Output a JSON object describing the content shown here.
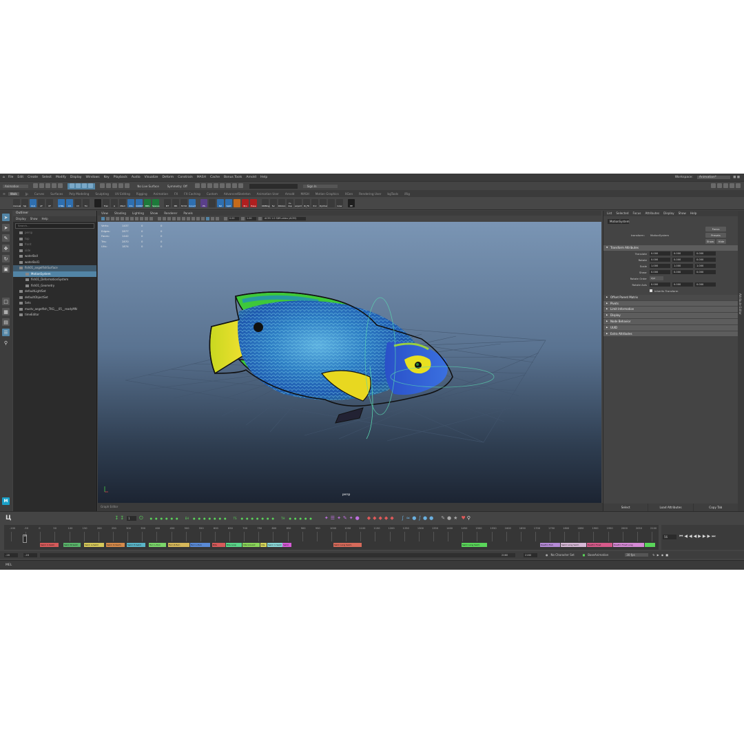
{
  "menus": [
    "File",
    "Edit",
    "Create",
    "Select",
    "Modify",
    "Display",
    "Windows",
    "Key",
    "Playback",
    "Audio",
    "Visualize",
    "Deform",
    "Constrain",
    "MASH",
    "Cache",
    "Bonus Tools",
    "Arnold",
    "Help"
  ],
  "workspace": {
    "label": "Workspace:",
    "value": "Animation*"
  },
  "status": {
    "mode": "Animation",
    "live": "No Live Surface",
    "symmetry": "Symmetry: Off",
    "sign_in": "Sign In"
  },
  "shelf_tabs": [
    "Walk",
    "Jp",
    "Curves",
    "Surfaces",
    "Poly Modeling",
    "Sculpting",
    "UV Editing",
    "Rigging",
    "Animation",
    "FX",
    "FX Caching",
    "Custom",
    "AdvancedSkeleton",
    "Animation User",
    "Arnold",
    "MASH",
    "Motion Graphics",
    "XGen",
    "Rendering User",
    "bgTools",
    "iRig"
  ],
  "shelf_active": "Walk",
  "shelf_icons": [
    {
      "label": "manual",
      "color": "#3a3a3a"
    },
    {
      "label": "hlp",
      "color": "#3a3a3a"
    },
    {
      "label": "CLS",
      "color": "#2e6fb0"
    },
    {
      "label": "AT",
      "color": "#3a3a3a"
    },
    {
      "label": "CF",
      "color": "#3a3a3a"
    },
    {
      "label": "CTRL",
      "color": "#2e6fb0"
    },
    {
      "label": "CV",
      "color": "#2e6fb0"
    },
    {
      "label": "CV",
      "color": "#3a3a3a"
    },
    {
      "label": "Tin",
      "color": "#3a3a3a"
    },
    {
      "label": "",
      "color": "#1f1f1f"
    },
    {
      "label": "Tran",
      "color": "#3a3a3a"
    },
    {
      "label": "A",
      "color": "#3a3a3a"
    },
    {
      "label": "XNull",
      "color": "#3a3a3a"
    },
    {
      "label": "P-S",
      "color": "#2e6fb0"
    },
    {
      "label": "CONST",
      "color": "#2e6fb0"
    },
    {
      "label": "BBS",
      "color": "#1d7a3a"
    },
    {
      "label": "Spaces",
      "color": "#1d7a3a"
    },
    {
      "label": "MT",
      "color": "#3a3a3a"
    },
    {
      "label": "MR",
      "color": "#3a3a3a"
    },
    {
      "label": "M-T-R",
      "color": "#3a3a3a"
    },
    {
      "label": "Convrt",
      "color": "#2e6fb0"
    },
    {
      "label": "PS",
      "color": "#5a3f8a"
    },
    {
      "label": "",
      "color": "#3a3a3a"
    },
    {
      "label": "NX",
      "color": "#2e6fb0"
    },
    {
      "label": "Split",
      "color": "#2e6fb0"
    },
    {
      "label": "",
      "color": "#c46a1a"
    },
    {
      "label": "Bro",
      "color": "#b01f1f"
    },
    {
      "label": "Ease",
      "color": "#b01f1f"
    },
    {
      "label": "ORBtog",
      "color": "#3a3a3a"
    },
    {
      "label": "fsc",
      "color": "#3a3a3a"
    },
    {
      "label": "Ribbon",
      "color": "#3a3a3a"
    },
    {
      "label": "cv-dup",
      "color": "#3a3a3a"
    },
    {
      "label": "export",
      "color": "#3a3a3a"
    },
    {
      "label": "IK_FK",
      "color": "#3a3a3a"
    },
    {
      "label": "P-U",
      "color": "#3a3a3a"
    },
    {
      "label": "DyChar",
      "color": "#3a3a3a"
    },
    {
      "label": "",
      "color": "#3a3a3a"
    },
    {
      "label": "Grav",
      "color": "#3a3a3a"
    },
    {
      "label": "EE",
      "color": "#1f1f1f"
    }
  ],
  "outliner": {
    "title": "Outliner",
    "menu": [
      "Display",
      "Show",
      "Help"
    ],
    "search": "Search...",
    "items": [
      {
        "label": "persp",
        "indent": 1,
        "state": "dim"
      },
      {
        "label": "top",
        "indent": 1,
        "state": "dim"
      },
      {
        "label": "front",
        "indent": 1,
        "state": "dim"
      },
      {
        "label": "side",
        "indent": 1,
        "state": "dim"
      },
      {
        "label": "waterBall",
        "indent": 1,
        "state": ""
      },
      {
        "label": "waterBall1",
        "indent": 1,
        "state": ""
      },
      {
        "label": "fish01_angelfishSurface",
        "indent": 1,
        "state": "hl"
      },
      {
        "label": "MotionSystem",
        "indent": 2,
        "state": "sel"
      },
      {
        "label": "fish01_DeformationSystem",
        "indent": 2,
        "state": ""
      },
      {
        "label": "fish01_Geometry",
        "indent": 2,
        "state": ""
      },
      {
        "label": "defaultLightSet",
        "indent": 1,
        "state": ""
      },
      {
        "label": "defaultObjectSet",
        "indent": 1,
        "state": ""
      },
      {
        "label": "Sets",
        "indent": 1,
        "state": ""
      },
      {
        "label": "mustv_angelfish_TKG___05__readyMN",
        "indent": 1,
        "state": ""
      },
      {
        "label": "timeEditor",
        "indent": 1,
        "state": ""
      }
    ]
  },
  "viewport": {
    "menu": [
      "View",
      "Shading",
      "Lighting",
      "Show",
      "Renderer",
      "Panels"
    ],
    "fields": [
      "0.00",
      "1.00"
    ],
    "color_space": "ACES 1.0 SDR-video (ACES)",
    "hud": [
      [
        "Verts:",
        "1437",
        "0",
        "0"
      ],
      [
        "Edges:",
        "2877",
        "0",
        "0"
      ],
      [
        "Faces:",
        "1442",
        "0",
        "0"
      ],
      [
        "Tris:",
        "2870",
        "0",
        "0"
      ],
      [
        "UVs:",
        "1874",
        "0",
        "0"
      ]
    ],
    "camera": "persp"
  },
  "attribute_editor": {
    "menu": [
      "List",
      "Selected",
      "Focus",
      "Attributes",
      "Display",
      "Show",
      "Help"
    ],
    "node": "MotionSystem",
    "transform_label": "transform:",
    "transform_value": "MotionSystem",
    "focus_btn": "Focus",
    "presets_btn": "Presets",
    "show_btn": "Show",
    "hide_btn": "Hide",
    "sections_top": "Transform Attributes",
    "transform_rows": [
      {
        "label": "Translate",
        "values": [
          "0.000",
          "0.000",
          "0.000"
        ]
      },
      {
        "label": "Rotate",
        "values": [
          "0.000",
          "0.000",
          "0.000"
        ]
      },
      {
        "label": "Scale",
        "values": [
          "1.000",
          "1.000",
          "1.000"
        ]
      },
      {
        "label": "Shear",
        "values": [
          "0.000",
          "0.000",
          "0.000"
        ]
      }
    ],
    "rotate_order": {
      "label": "Rotate Order",
      "value": "xyz"
    },
    "rotate_axis": {
      "label": "Rotate Axis",
      "values": [
        "0.000",
        "0.000",
        "0.000"
      ]
    },
    "inherits": "Inherits Transform",
    "offset_parent": "Offset Parent Matrix",
    "sections": [
      "Pivots",
      "Limit Information",
      "Display",
      "Node Behavior",
      "UUID",
      "Extra Attributes"
    ],
    "bottom": [
      "Select",
      "Load Attributes",
      "Copy Tab"
    ],
    "side_tab": "Attribute Editor"
  },
  "graph_bar": "Graph Editor",
  "anim_bar": {
    "current_frame": "1",
    "markers": [
      "EH",
      "TS",
      "TH"
    ]
  },
  "timeline": {
    "ticks": [
      "-100",
      "-50",
      "0",
      "50",
      "100",
      "150",
      "200",
      "250",
      "300",
      "350",
      "400",
      "450",
      "500",
      "550",
      "600",
      "650",
      "700",
      "750",
      "800",
      "850",
      "900",
      "950",
      "1000",
      "1050",
      "1100",
      "1150",
      "1200",
      "1250",
      "1300",
      "1350",
      "1400",
      "1450",
      "1500",
      "1550",
      "1600",
      "1650",
      "1700",
      "1750",
      "1800",
      "1850",
      "1900",
      "1950",
      "2000",
      "2050",
      "2100"
    ],
    "current": "-16",
    "clips": [
      {
        "label": "Swim C-Swim",
        "color": "#d65a5a",
        "start": 52,
        "width": 26
      },
      {
        "label": "Swim B-Swim",
        "color": "#5ab56b",
        "start": 86,
        "width": 24
      },
      {
        "label": "Swim A-Swim",
        "color": "#d6c85a",
        "start": 116,
        "width": 28
      },
      {
        "label": "Swim D-Swim",
        "color": "#d68a4a",
        "start": 148,
        "width": 26
      },
      {
        "label": "Swim E-Swim",
        "color": "#5ab5c8",
        "start": 178,
        "width": 26
      },
      {
        "label": "Turn L-Turn",
        "color": "#7ad66a",
        "start": 210,
        "width": 24
      },
      {
        "label": "Turn R-Turn",
        "color": "#d6b85a",
        "start": 238,
        "width": 30
      },
      {
        "label": "Turn L-Turn",
        "color": "#5a8ad6",
        "start": 270,
        "width": 28
      },
      {
        "label": "Bite",
        "color": "#d65a5a",
        "start": 302,
        "width": 18
      },
      {
        "label": "Bite Loop",
        "color": "#5ad68a",
        "start": 322,
        "width": 22
      },
      {
        "label": "Idle Ground",
        "color": "#8ad65a",
        "start": 346,
        "width": 24
      },
      {
        "label": "Idle",
        "color": "#d6d65a",
        "start": 372,
        "width": 8
      },
      {
        "label": "Swim C-Swim",
        "color": "#8ad6d6",
        "start": 382,
        "width": 22
      },
      {
        "label": "Swim",
        "color": "#d65ad6",
        "start": 404,
        "width": 12
      },
      {
        "label": "Swim Long Swim",
        "color": "#d66a5a",
        "start": 478,
        "width": 40
      },
      {
        "label": "Swim Long Swim",
        "color": "#5ad65a",
        "start": 664,
        "width": 36
      },
      {
        "label": "Death1 Fish",
        "color": "#b58ad6",
        "start": 778,
        "width": 28
      },
      {
        "label": "Swim Long Swim",
        "color": "#d6b8d6",
        "start": 808,
        "width": 36
      },
      {
        "label": "Death1 Float",
        "color": "#d65a8a",
        "start": 846,
        "width": 36
      },
      {
        "label": "Death1 Float Long",
        "color": "#d68ad6",
        "start": 884,
        "width": 44
      },
      {
        "label": "",
        "color": "#5ad65a",
        "start": 930,
        "width": 14
      }
    ],
    "field": "56"
  },
  "range": {
    "start": "-16",
    "inner_start": "-16",
    "inner_end": "2160",
    "end": "2160",
    "char_set": "No Character Set",
    "anim_layer": "BaseAnimation",
    "fps": "30 fps"
  },
  "cmd_label": "MEL"
}
